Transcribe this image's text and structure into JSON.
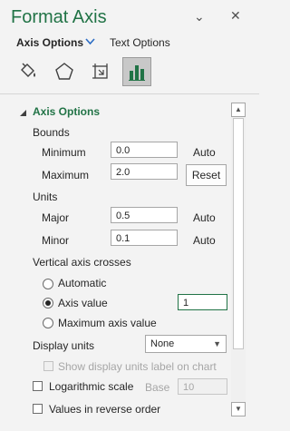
{
  "pane": {
    "title": "Format Axis"
  },
  "header": {
    "pin_glyph": "⌄",
    "close_glyph": "✕"
  },
  "tabs": {
    "axis_options": "Axis Options",
    "text_options": "Text Options"
  },
  "section": {
    "title": "Axis Options"
  },
  "bounds": {
    "label": "Bounds",
    "min_label": "Minimum",
    "min_value": "0.0",
    "min_auto": "Auto",
    "max_label": "Maximum",
    "max_value": "2.0",
    "max_action": "Reset"
  },
  "units": {
    "label": "Units",
    "major_label": "Major",
    "major_value": "0.5",
    "major_auto": "Auto",
    "minor_label": "Minor",
    "minor_value": "0.1",
    "minor_auto": "Auto"
  },
  "crosses": {
    "label": "Vertical axis crosses",
    "automatic": "Automatic",
    "axis_value": "Axis value",
    "axis_value_input": "1",
    "max_value": "Maximum axis value",
    "selected": "Axis value"
  },
  "display_units": {
    "label": "Display units",
    "value": "None",
    "show_label": "Show display units label on chart"
  },
  "log_scale": {
    "label": "Logarithmic scale",
    "base_label": "Base",
    "base_value": "10"
  },
  "reverse": {
    "label": "Values in reverse order"
  }
}
